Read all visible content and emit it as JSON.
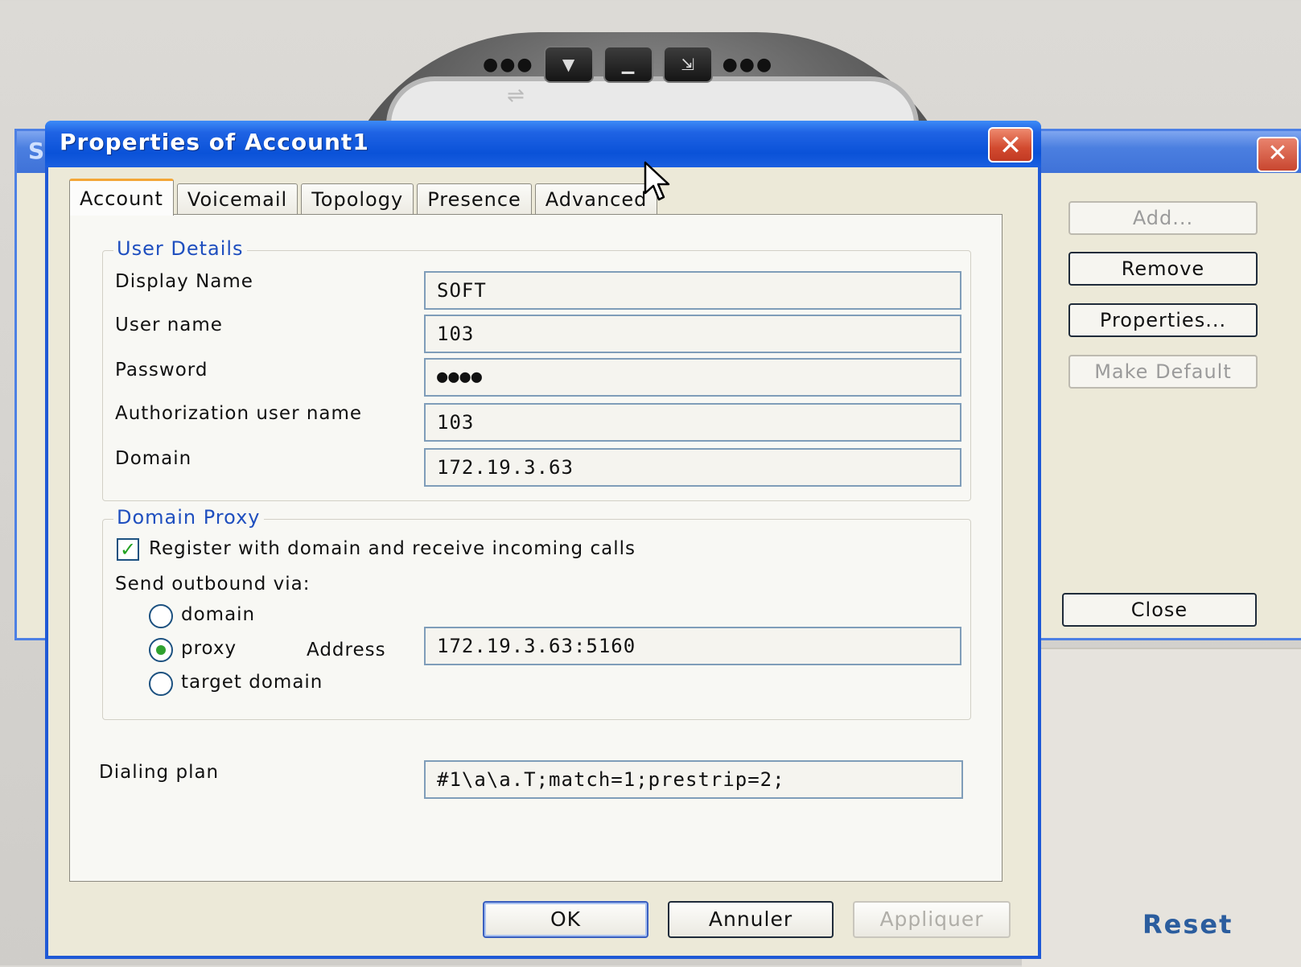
{
  "background_window": {
    "title_fragment": "S",
    "buttons": {
      "add": "Add...",
      "remove": "Remove",
      "properties": "Properties...",
      "make_default": "Make Default",
      "close": "Close"
    },
    "footer": {
      "fragment": "t",
      "reset": "Reset"
    }
  },
  "dialog": {
    "title": "Properties of Account1",
    "close_symbol": "✕",
    "tabs": [
      "Account",
      "Voicemail",
      "Topology",
      "Presence",
      "Advanced"
    ],
    "active_tab": "Account",
    "user_details": {
      "legend": "User Details",
      "display_name": {
        "label": "Display Name",
        "value": "SOFT"
      },
      "user_name": {
        "label": "User name",
        "value": "103"
      },
      "password": {
        "label": "Password",
        "value": "●●●●"
      },
      "auth_user_name": {
        "label": "Authorization user name",
        "value": "103"
      },
      "domain": {
        "label": "Domain",
        "value": "172.19.3.63"
      }
    },
    "domain_proxy": {
      "legend": "Domain Proxy",
      "register_checkbox": {
        "label": "Register with domain and receive incoming calls",
        "checked": true
      },
      "send_outbound_label": "Send outbound via:",
      "options": [
        {
          "label": "domain",
          "checked": false
        },
        {
          "label": "proxy",
          "checked": true
        },
        {
          "label": "target domain",
          "checked": false
        }
      ],
      "address": {
        "label": "Address",
        "value": "172.19.3.63:5160"
      }
    },
    "dialing_plan": {
      "label": "Dialing plan",
      "value": "#1\\a\\a.T;match=1;prestrip=2;"
    },
    "buttons": {
      "ok": "OK",
      "cancel": "Annuler",
      "apply": "Appliquer"
    }
  },
  "colors": {
    "titlebar_blue": "#0a52d8",
    "legend_blue": "#1f4fbf",
    "close_red": "#d24a2f",
    "check_green": "#21a121"
  }
}
